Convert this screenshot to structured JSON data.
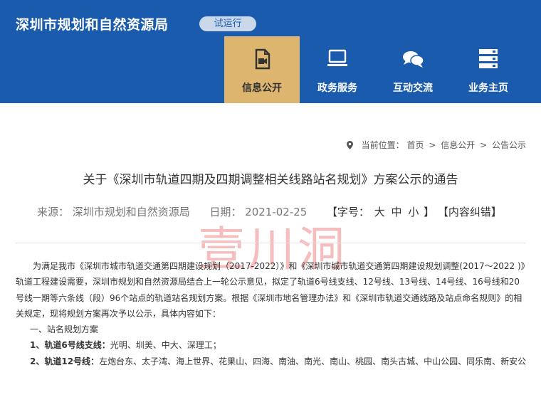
{
  "site": {
    "title": "深圳市规划和自然资源局",
    "badge": "试运行"
  },
  "nav": [
    {
      "label": "信息公开",
      "icon": "document-video-icon",
      "active": true
    },
    {
      "label": "政务服务",
      "icon": "monitor-icon",
      "active": false
    },
    {
      "label": "互动交流",
      "icon": "chat-bubbles-icon",
      "active": false
    },
    {
      "label": "业务主页",
      "icon": "server-icon",
      "active": false
    }
  ],
  "breadcrumb": {
    "prefix": "当前位置：",
    "items": [
      "首页",
      "信息公开",
      "公告公示"
    ],
    "separator": ">"
  },
  "article": {
    "title": "关于《深圳市轨道四期及四期调整相关线路站名规划》方案公示的通告",
    "source_label": "来源：",
    "source": "深圳市规划和自然资源局",
    "date_label": "日期：",
    "date": "2021-02-25",
    "fontsize_label": "【字号：",
    "fontsize_options": [
      "大",
      "中",
      "小"
    ],
    "fontsize_close": "】",
    "correction": "【内容纠错】",
    "watermark": "壹川洞",
    "intro": "为满足我市《深圳市城市轨道交通第四期建设规划（2017-2022）》和《深圳市城市轨道交通第四期建设规划调整(2017～2022 )》轨道工程建设需要，深圳市规划和自然资源局结合上一轮公示意见，拟定了轨道6号线支线、12号线、13号线、14号线、16号线和20号线一期等六条线（段）96个站点的轨道站名规划方案。根据《深圳市地名管理办法》和《深圳市轨道交通线路及站点命名规则》的相关规定，现将规划方案再次予以公示，具体内容如下：",
    "section1": "一、站名规划方案",
    "line6_label": "1、轨道6号线支线：",
    "line6_stations": "光明、圳美、中大、深理工；",
    "line12_label": "2、轨道12号线：",
    "line12_stations": "左炮台东、太子湾、海上世界、花果山、四海、南油、南光、南山、桃园、南头古城、中山公园、同乐南、新安公"
  },
  "colors": {
    "header_bg": "#1a5bad",
    "active_nav": "#deb56f",
    "badge_bg": "#c9d7ea"
  }
}
